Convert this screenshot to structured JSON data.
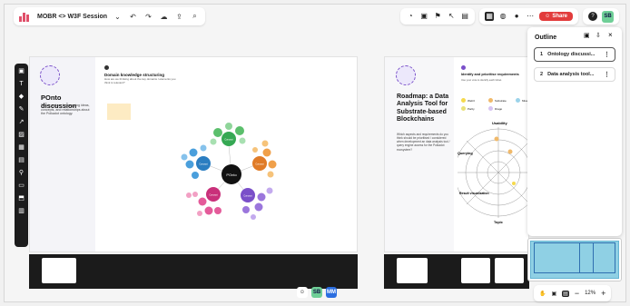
{
  "board": {
    "title": "MOBR <> W3F Session",
    "title_chevron": "⌄",
    "toolbar_icons": [
      "undo-icon",
      "redo-icon",
      "cloud-icon",
      "upload-icon",
      "search-icon"
    ]
  },
  "top_right": {
    "share_label": "Share",
    "help_label": "?",
    "avatar_initials": "SB"
  },
  "left_slide": {
    "title": "POnto discussion",
    "subtitle": "This is a place for mapping ideas, concepts, and relationships about the Polkadot ontology.",
    "section_title": "Domain knowledge structuring",
    "section_text": "How are we thinking about the key domains / elements you think is relevant?",
    "center_node": "POnto",
    "concepts": [
      "Concept",
      "Concept",
      "Concept",
      "Concept",
      "Concept",
      "Concept"
    ]
  },
  "right_slide": {
    "title": "Roadmap: a Data Analysis Tool for Substrate-based Blockchains",
    "desc": "Which aspects and requirements do you think should be prioritised / considered when development an data analysis tool / query engine access for the Polkadot ecosystem?",
    "section_title": "Identify and prioritise requirements",
    "section_text": "Use your vote to identify each ticket.",
    "legend": [
      "Web3",
      "Substrate",
      "Parity",
      "Drago",
      "Mixed"
    ],
    "radar_labels": [
      "Usability",
      "Querying",
      "Result visualization",
      "Topic"
    ]
  },
  "outline": {
    "title": "Outline",
    "items": [
      {
        "num": "1",
        "label": "Ontology discussi..."
      },
      {
        "num": "2",
        "label": "Data analysis tool..."
      }
    ]
  },
  "zoom": {
    "level": "12%",
    "minus": "−",
    "plus": "+"
  },
  "collab": [
    "SB",
    "MM"
  ],
  "colors": {
    "green": "#35a853",
    "orange": "#e07b27",
    "blue": "#2b7ec1",
    "magenta": "#c9307a",
    "purple": "#7a4fc9",
    "share": "#e23c3c"
  }
}
